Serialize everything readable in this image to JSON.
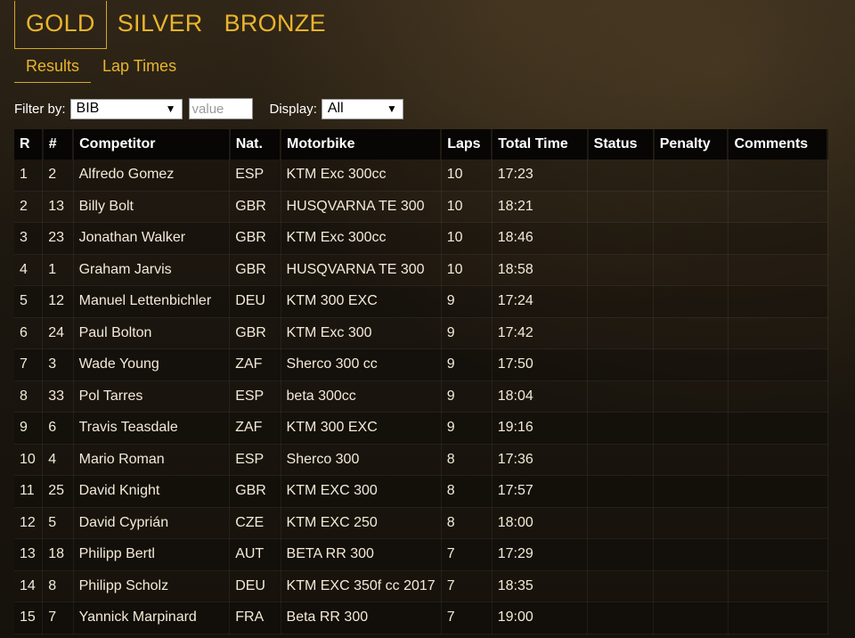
{
  "tabs": {
    "gold": "GOLD",
    "silver": "SILVER",
    "bronze": "BRONZE"
  },
  "subtabs": {
    "results": "Results",
    "lap_times": "Lap Times"
  },
  "filter": {
    "label": "Filter by:",
    "selected": "BIB",
    "value_placeholder": "value",
    "display_label": "Display:",
    "display_selected": "All"
  },
  "table": {
    "headers": [
      "R",
      "#",
      "Competitor",
      "Nat.",
      "Motorbike",
      "Laps",
      "Total Time",
      "Status",
      "Penalty",
      "Comments"
    ],
    "rows": [
      [
        "1",
        "2",
        "Alfredo Gomez",
        "ESP",
        "KTM Exc 300cc",
        "10",
        "17:23",
        "",
        "",
        ""
      ],
      [
        "2",
        "13",
        "Billy Bolt",
        "GBR",
        "HUSQVARNA TE 300",
        "10",
        "18:21",
        "",
        "",
        ""
      ],
      [
        "3",
        "23",
        "Jonathan Walker",
        "GBR",
        "KTM Exc 300cc",
        "10",
        "18:46",
        "",
        "",
        ""
      ],
      [
        "4",
        "1",
        "Graham Jarvis",
        "GBR",
        "HUSQVARNA TE 300",
        "10",
        "18:58",
        "",
        "",
        ""
      ],
      [
        "5",
        "12",
        "Manuel Lettenbichler",
        "DEU",
        "KTM 300 EXC",
        "9",
        "17:24",
        "",
        "",
        ""
      ],
      [
        "6",
        "24",
        "Paul Bolton",
        "GBR",
        "KTM Exc 300",
        "9",
        "17:42",
        "",
        "",
        ""
      ],
      [
        "7",
        "3",
        "Wade Young",
        "ZAF",
        "Sherco 300 cc",
        "9",
        "17:50",
        "",
        "",
        ""
      ],
      [
        "8",
        "33",
        "Pol Tarres",
        "ESP",
        "beta 300cc",
        "9",
        "18:04",
        "",
        "",
        ""
      ],
      [
        "9",
        "6",
        "Travis Teasdale",
        "ZAF",
        "KTM 300 EXC",
        "9",
        "19:16",
        "",
        "",
        ""
      ],
      [
        "10",
        "4",
        "Mario Roman",
        "ESP",
        "Sherco 300",
        "8",
        "17:36",
        "",
        "",
        ""
      ],
      [
        "11",
        "25",
        "David Knight",
        "GBR",
        "KTM EXC 300",
        "8",
        "17:57",
        "",
        "",
        ""
      ],
      [
        "12",
        "5",
        "David Cyprián",
        "CZE",
        "KTM EXC 250",
        "8",
        "18:00",
        "",
        "",
        ""
      ],
      [
        "13",
        "18",
        "Philipp Bertl",
        "AUT",
        "BETA RR 300",
        "7",
        "17:29",
        "",
        "",
        ""
      ],
      [
        "14",
        "8",
        "Philipp Scholz",
        "DEU",
        "KTM EXC 350f cc 2017",
        "7",
        "18:35",
        "",
        "",
        ""
      ],
      [
        "15",
        "7",
        "Yannick Marpinard",
        "FRA",
        "Beta RR 300",
        "7",
        "19:00",
        "",
        "",
        ""
      ]
    ]
  },
  "colors": {
    "accent": "#e9b52c",
    "header_bg": "#070605",
    "text": "#f3ead8"
  }
}
